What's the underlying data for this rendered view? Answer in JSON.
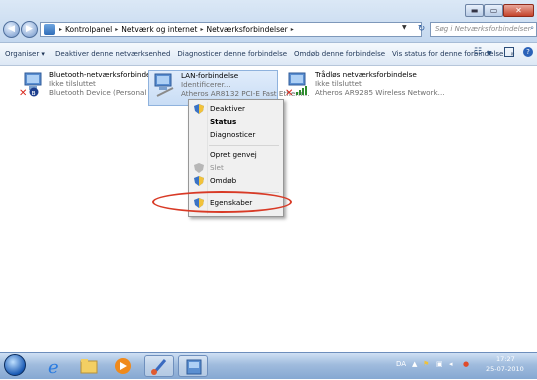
{
  "window": {
    "min_symbol": "▬",
    "max_symbol": "▭",
    "close_symbol": "✕"
  },
  "address": {
    "crumbs": [
      "Kontrolpanel",
      "Netværk og internet",
      "Netværksforbindelser"
    ],
    "separator": "▸",
    "search_placeholder": "Søg i Netværksforbindelser"
  },
  "toolbar": {
    "organize": "Organiser ▾",
    "disable_device": "Deaktiver denne netværksenhed",
    "diagnose": "Diagnosticer denne forbindelse",
    "rename": "Omdøb denne forbindelse",
    "view_status": "Vis status for denne forbindelse",
    "more": "»"
  },
  "connections": [
    {
      "name": "Bluetooth-netværksforbindelse",
      "status": "Ikke tilsluttet",
      "device": "Bluetooth Device (Personal Area ..."
    },
    {
      "name": "LAN-forbindelse",
      "status": "Identificerer...",
      "device": "Atheros AR8132 PCI-E Fast Ethern..."
    },
    {
      "name": "Trådløs netværksforbindelse",
      "status": "Ikke tilsluttet",
      "device": "Atheros AR9285 Wireless Network..."
    }
  ],
  "context_menu": {
    "disable": "Deaktiver",
    "status": "Status",
    "diagnose": "Diagnosticer",
    "create_shortcut": "Opret genvej",
    "delete": "Slet",
    "rename": "Omdøb",
    "properties": "Egenskaber"
  },
  "taskbar": {
    "language": "DA",
    "time": "17:27",
    "date": "25-07-2010"
  },
  "colors": {
    "annotation": "#d83a26",
    "selection": "#c9ddf5"
  }
}
